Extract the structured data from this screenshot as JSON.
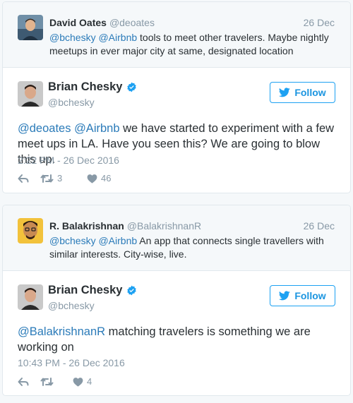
{
  "thread1": {
    "context": {
      "name": "David Oates",
      "handle": "@deoates",
      "date": "26 Dec",
      "mention1": "@bchesky",
      "mention2": "@Airbnb",
      "text": " tools to meet other travelers. Maybe nightly meetups in ever major city at same, designated location"
    },
    "reply": {
      "name": "Brian Chesky",
      "handle": "@bchesky",
      "follow_label": "Follow",
      "mention1": "@deoates",
      "mention2": "@Airbnb",
      "text": " we have started to experiment with a few meet ups in LA. Have you seen this? We are going to blow this up.",
      "time": "2:22 PM - 26 Dec 2016",
      "retweets": "3",
      "likes": "46"
    }
  },
  "thread2": {
    "context": {
      "name": "R. Balakrishnan",
      "handle": "@BalakrishnanR",
      "date": "26 Dec",
      "mention1": "@bchesky",
      "mention2": "@Airbnb",
      "text": " An app that connects single travellers with similar interests. City-wise, live."
    },
    "reply": {
      "name": "Brian Chesky",
      "handle": "@bchesky",
      "follow_label": "Follow",
      "mention1": "@BalakrishnanR",
      "text": " matching travelers is something we are working on",
      "time": "10:43 PM - 26 Dec 2016",
      "likes": "4"
    }
  },
  "colors": {
    "link": "#2b7bb9",
    "follow": "#1da1f2",
    "muted": "#8899a6",
    "text": "#292f33",
    "verified": "#1da1f2"
  },
  "icons": [
    "reply-icon",
    "retweet-icon",
    "like-icon",
    "bird-icon",
    "verified-badge-icon"
  ]
}
